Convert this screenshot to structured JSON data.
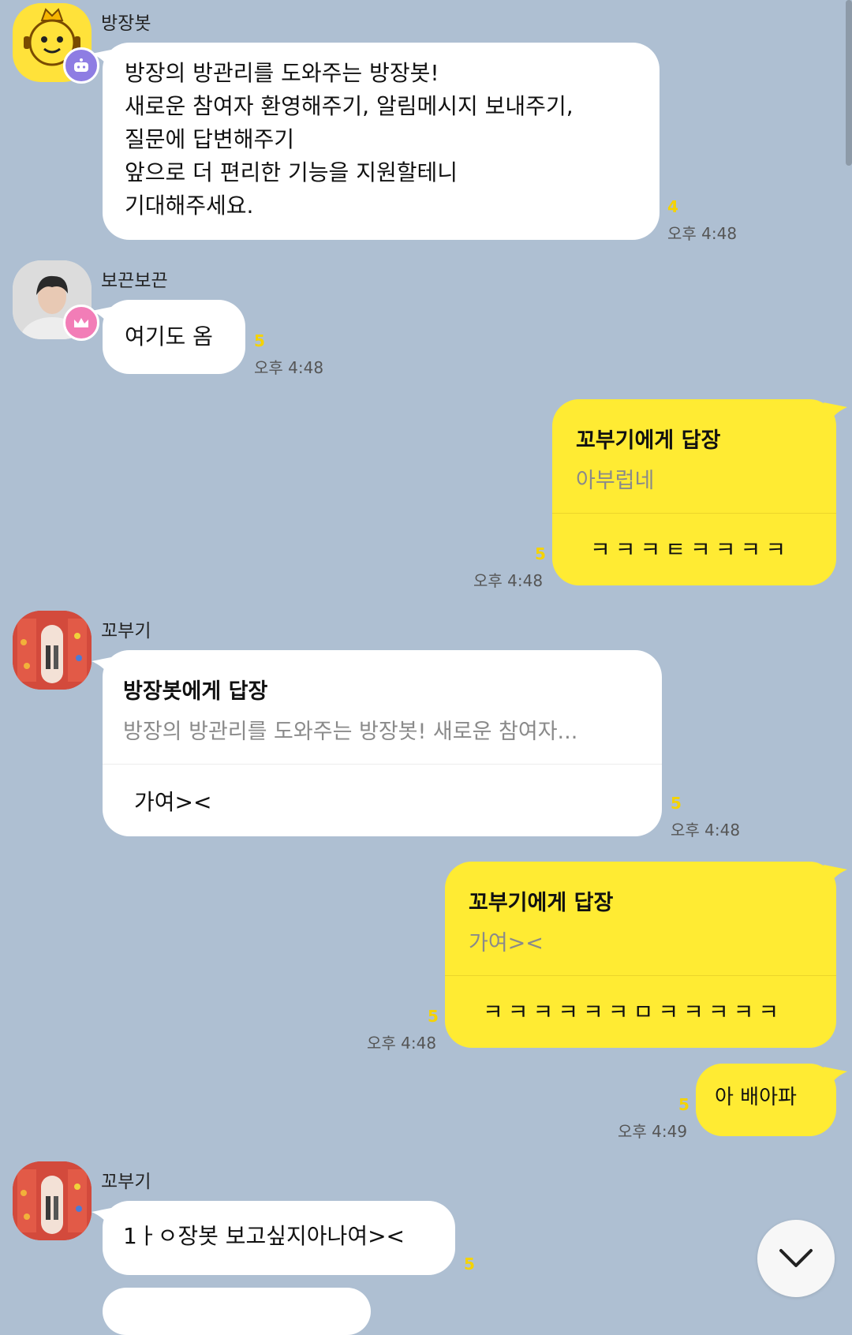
{
  "messages": {
    "bot": {
      "sender": "방장봇",
      "text": "방장의 방관리를 도와주는 방장봇!\n새로운 참여자 환영해주기, 알림메시지 보내주기,\n질문에 답변해주기\n앞으로 더 편리한 기능을 지원할테니\n기대해주세요.",
      "unread": "4",
      "time": "오후 4:48",
      "avatar_icon": "robot-face-icon",
      "badge_icon": "bot-icon"
    },
    "bokkeun": {
      "sender": "보끈보끈",
      "text": "여기도 옴",
      "unread": "5",
      "time": "오후 4:48",
      "badge_icon": "crown-icon"
    },
    "my_reply_1": {
      "reply_title": "꼬부기에게 답장",
      "reply_quote": "아부럽네",
      "text": "ㅋㅋㅋㅌㅋㅋㅋㅋ",
      "unread": "5",
      "time": "오후 4:48"
    },
    "kkobugi_1": {
      "sender": "꼬부기",
      "reply_title": "방장봇에게 답장",
      "reply_quote": "방장의 방관리를 도와주는 방장봇! 새로운 참여자...",
      "text": "가여><",
      "unread": "5",
      "time": "오후 4:48"
    },
    "my_reply_2": {
      "reply_title": "꼬부기에게 답장",
      "reply_quote": "가여><",
      "text": "ㅋㅋㅋㅋㅋㅋㅁㅋㅋㅋㅋㅋ",
      "unread": "5",
      "time": "오후 4:48"
    },
    "my_msg": {
      "text": "아 배아파",
      "unread": "5",
      "time": "오후 4:49"
    },
    "kkobugi_2": {
      "sender": "꼬부기",
      "text": "1ㅏㅇ장봇 보고싶지아나여><",
      "unread": "5"
    }
  },
  "scroll_button": {
    "icon": "chevron-down-icon"
  },
  "colors": {
    "background": "#aebfd2",
    "my_bubble": "#ffeb33",
    "other_bubble": "#ffffff",
    "unread": "#f5d300"
  }
}
